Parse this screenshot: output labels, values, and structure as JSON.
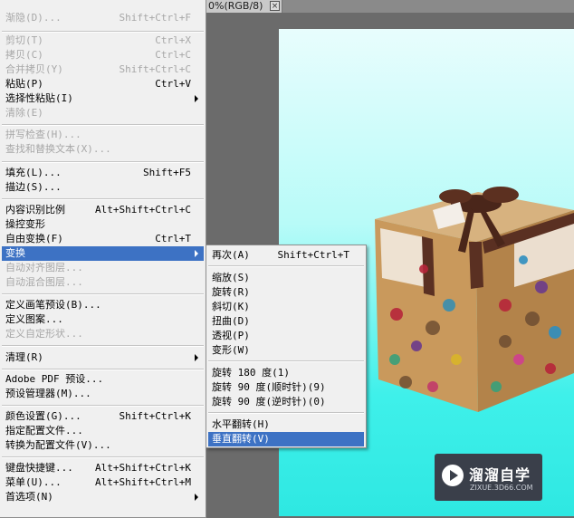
{
  "document": {
    "tab_title": "0%(RGB/8)",
    "close_label": "×"
  },
  "edit_menu": {
    "items": [
      {
        "label": "渐隐(D)...",
        "shortcut": "Shift+Ctrl+F",
        "disabled": true
      },
      {
        "label": "剪切(T)",
        "shortcut": "Ctrl+X",
        "disabled": true
      },
      {
        "label": "拷贝(C)",
        "shortcut": "Ctrl+C",
        "disabled": true
      },
      {
        "label": "合并拷贝(Y)",
        "shortcut": "Shift+Ctrl+C",
        "disabled": true
      },
      {
        "label": "粘贴(P)",
        "shortcut": "Ctrl+V",
        "disabled": false
      },
      {
        "label": "选择性粘贴(I)",
        "shortcut": "",
        "disabled": false,
        "submenu": true
      },
      {
        "label": "清除(E)",
        "shortcut": "",
        "disabled": true
      },
      {
        "label": "拼写检查(H)...",
        "shortcut": "",
        "disabled": true
      },
      {
        "label": "查找和替换文本(X)...",
        "shortcut": "",
        "disabled": true
      },
      {
        "label": "填充(L)...",
        "shortcut": "Shift+F5",
        "disabled": false
      },
      {
        "label": "描边(S)...",
        "shortcut": "",
        "disabled": false
      },
      {
        "label": "内容识别比例",
        "shortcut": "Alt+Shift+Ctrl+C",
        "disabled": false
      },
      {
        "label": "操控变形",
        "shortcut": "",
        "disabled": false
      },
      {
        "label": "自由变换(F)",
        "shortcut": "Ctrl+T",
        "disabled": false
      },
      {
        "label": "变换",
        "shortcut": "",
        "disabled": false,
        "submenu": true,
        "highlighted": true
      },
      {
        "label": "自动对齐图层...",
        "shortcut": "",
        "disabled": true
      },
      {
        "label": "自动混合图层...",
        "shortcut": "",
        "disabled": true
      },
      {
        "label": "定义画笔预设(B)...",
        "shortcut": "",
        "disabled": false
      },
      {
        "label": "定义图案...",
        "shortcut": "",
        "disabled": false
      },
      {
        "label": "定义自定形状...",
        "shortcut": "",
        "disabled": true
      },
      {
        "label": "清理(R)",
        "shortcut": "",
        "disabled": false,
        "submenu": true
      },
      {
        "label": "Adobe PDF 预设...",
        "shortcut": "",
        "disabled": false
      },
      {
        "label": "预设管理器(M)...",
        "shortcut": "",
        "disabled": false
      },
      {
        "label": "颜色设置(G)...",
        "shortcut": "Shift+Ctrl+K",
        "disabled": false
      },
      {
        "label": "指定配置文件...",
        "shortcut": "",
        "disabled": false
      },
      {
        "label": "转换为配置文件(V)...",
        "shortcut": "",
        "disabled": false
      },
      {
        "label": "键盘快捷键...",
        "shortcut": "Alt+Shift+Ctrl+K",
        "disabled": false
      },
      {
        "label": "菜单(U)...",
        "shortcut": "Alt+Shift+Ctrl+M",
        "disabled": false
      },
      {
        "label": "首选项(N)",
        "shortcut": "",
        "disabled": false,
        "submenu": true
      }
    ]
  },
  "transform_menu": {
    "items": [
      {
        "label": "再次(A)",
        "shortcut": "Shift+Ctrl+T"
      },
      {
        "label": "缩放(S)",
        "shortcut": ""
      },
      {
        "label": "旋转(R)",
        "shortcut": ""
      },
      {
        "label": "斜切(K)",
        "shortcut": ""
      },
      {
        "label": "扭曲(D)",
        "shortcut": ""
      },
      {
        "label": "透视(P)",
        "shortcut": ""
      },
      {
        "label": "变形(W)",
        "shortcut": ""
      },
      {
        "label": "旋转 180 度(1)",
        "shortcut": ""
      },
      {
        "label": "旋转 90 度(顺时针)(9)",
        "shortcut": ""
      },
      {
        "label": "旋转 90 度(逆时针)(0)",
        "shortcut": ""
      },
      {
        "label": "水平翻转(H)",
        "shortcut": ""
      },
      {
        "label": "垂直翻转(V)",
        "shortcut": "",
        "highlighted": true
      }
    ]
  },
  "watermark": {
    "title": "溜溜自学",
    "subtitle": "ZIXUE.3D66.COM",
    "icon": "play-icon"
  },
  "colors": {
    "highlight": "#3d72c4",
    "menu_bg": "#f0f0f0",
    "canvas_top": "#e8fdfd",
    "canvas_bottom": "#2ee8e2"
  }
}
